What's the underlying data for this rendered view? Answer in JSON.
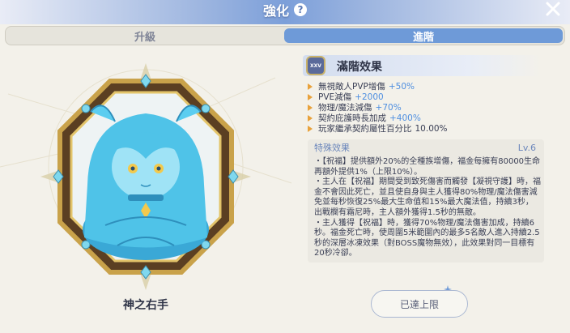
{
  "header": {
    "title": "強化",
    "help_glyph": "?"
  },
  "tabs": [
    {
      "label": "升級",
      "active": false
    },
    {
      "label": "進階",
      "active": true
    }
  ],
  "item": {
    "name": "神之右手",
    "badge_text": "XXV"
  },
  "effects": {
    "title": "滿階效果",
    "stats": [
      {
        "label": "無視敵人PVP增傷",
        "value": "+50%"
      },
      {
        "label": "PVE減傷",
        "value": "+2000"
      },
      {
        "label": "物理/魔法減傷",
        "value": "+70%"
      },
      {
        "label": "契約庇護時長加成",
        "value": "+400%"
      },
      {
        "label": "玩家繼承契約屬性百分比",
        "value": "10.00%"
      }
    ]
  },
  "special": {
    "title": "特殊效果",
    "level": "Lv.6",
    "text": "・【祝福】提供額外20%的全種族增傷，福金每擁有80000生命再額外提供1%（上限10%）。\n・主人在【祝福】期間受到致死傷害而觸發【凝視守護】時，福金不會因此死亡，並且使自身與主人獲得80%物理/魔法傷害減免並每秒恢復25%最大生命值和15%最大魔法值，持續3秒，出戰欄有霜尼時，主人額外獲得1.5秒的無敵。\n・主人獲得【祝福】時，獲得70%物理/魔法傷害加成，持續6秒。福金死亡時，使周圍5米範圍內的最多5名敵人進入持續2.5秒的深層冰凍效果（對BOSS魔物無效），此效果對同一目標有20秒冷卻。"
  },
  "actions": {
    "max_label": "已達上限"
  },
  "colors": {
    "accent": "#6e9ad8",
    "stat_value": "#4f8fe0",
    "gold": "#c9a24a",
    "statue": "#4fc3e8"
  },
  "icons": {
    "help": "help-icon",
    "close": "close-icon",
    "bullet": "arrow-bullet-icon",
    "badge": "tier-badge-icon",
    "sparkle": "sparkle-icon"
  }
}
